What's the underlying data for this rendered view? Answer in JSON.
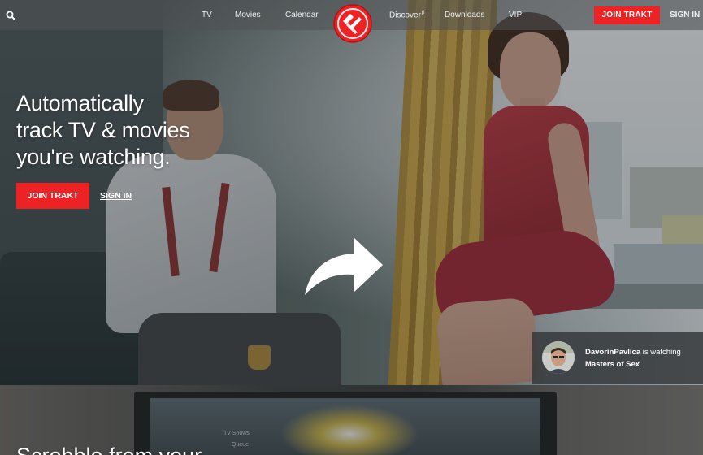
{
  "nav": {
    "links": [
      "TV",
      "Movies",
      "Calendar",
      "Discover",
      "Downloads",
      "VIP"
    ],
    "discover_badge": "β",
    "join_label": "JOIN TRAKT",
    "signin_label": "SIGN IN",
    "accent_color": "#ed2224"
  },
  "hero": {
    "headline_lines": [
      "Automatically",
      "track TV & movies",
      "you're watching."
    ],
    "join_label": "JOIN TRAKT",
    "signin_label": "SIGN IN"
  },
  "watching": {
    "user": "DavorinPavlica",
    "action": "is watching",
    "title": "Masters of Sex"
  },
  "section2": {
    "headline": "Scrobble from your",
    "tv_menu": [
      "TV Shows",
      "Queue"
    ]
  },
  "icons": {
    "search": "search-icon",
    "logo": "trakt-logo-icon",
    "arrow": "curved-arrow-icon"
  }
}
